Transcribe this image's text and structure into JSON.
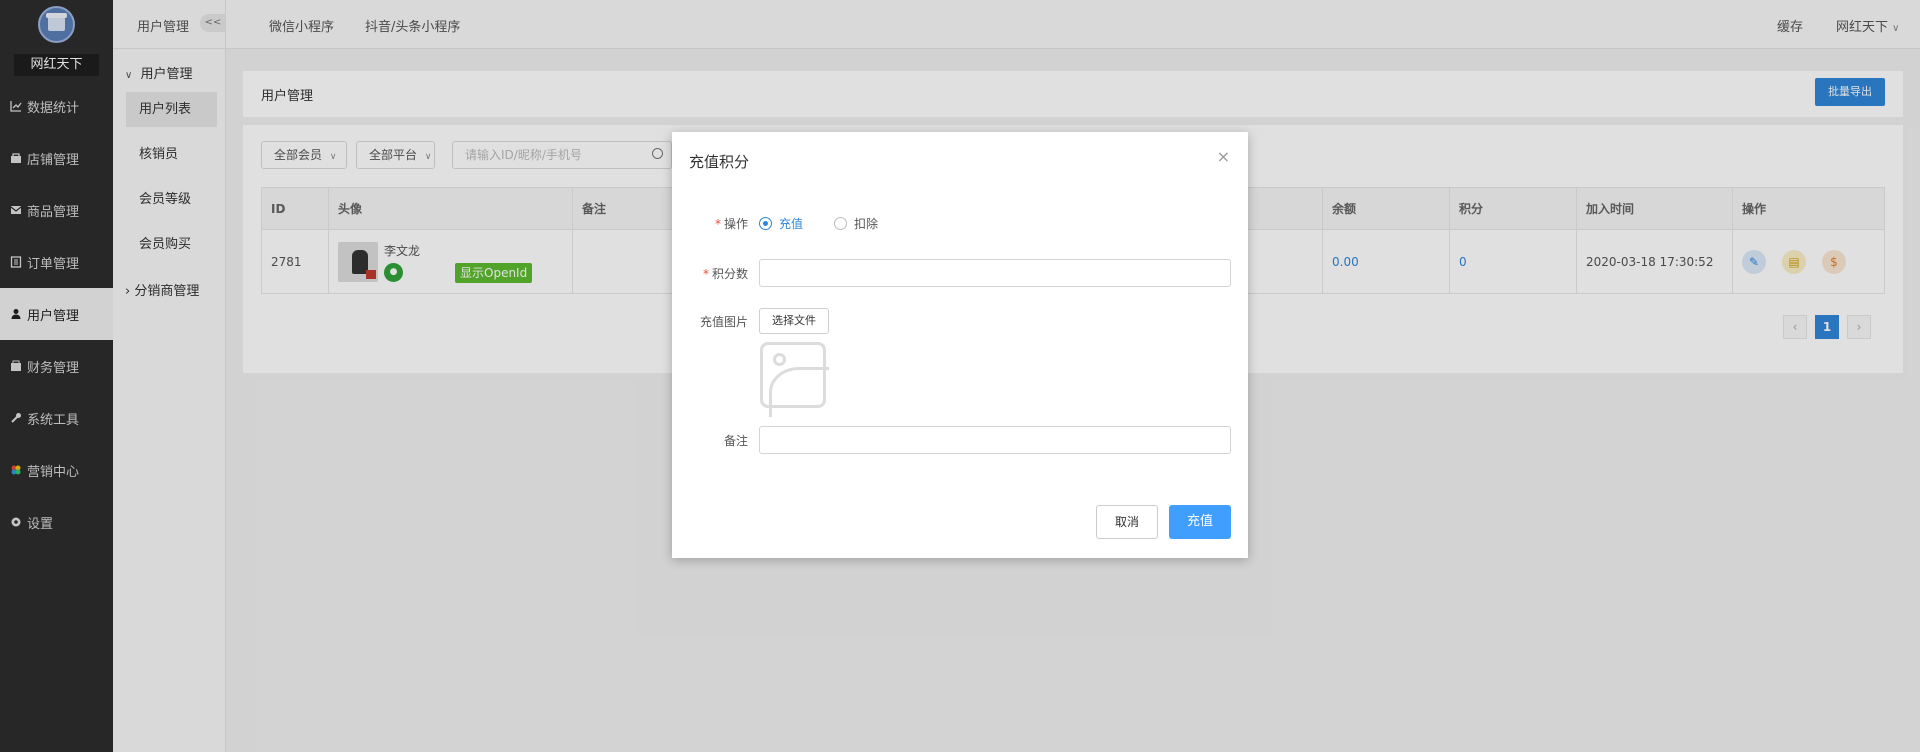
{
  "sidebar": {
    "brand": "网红天下",
    "items": [
      {
        "label": "数据统计",
        "icon": "chart-icon"
      },
      {
        "label": "店铺管理",
        "icon": "shop-icon"
      },
      {
        "label": "商品管理",
        "icon": "goods-icon"
      },
      {
        "label": "订单管理",
        "icon": "order-icon"
      },
      {
        "label": "用户管理",
        "icon": "user-icon",
        "active": true
      },
      {
        "label": "财务管理",
        "icon": "finance-icon"
      },
      {
        "label": "系统工具",
        "icon": "wrench-icon"
      },
      {
        "label": "营销中心",
        "icon": "marketing-icon"
      },
      {
        "label": "设置",
        "icon": "gear-icon"
      }
    ]
  },
  "subnav": {
    "header": "用户管理",
    "collapse": "<<",
    "group": "用户管理",
    "items": [
      "用户列表",
      "核销员",
      "会员等级",
      "会员购买"
    ],
    "group2": "分销商管理"
  },
  "topbar": {
    "tabs": [
      "微信小程序",
      "抖音/头条小程序"
    ],
    "cache": "缓存",
    "user": "网红天下"
  },
  "page": {
    "title": "用户管理",
    "export": "批量导出",
    "filters": {
      "member": "全部会员",
      "platform": "全部平台",
      "search_placeholder": "请输入ID/昵称/手机号"
    },
    "table": {
      "headers": {
        "id": "ID",
        "avatar": "头像",
        "remark": "备注",
        "balance": "余额",
        "points": "积分",
        "joined": "加入时间",
        "ops": "操作"
      },
      "row": {
        "id": "2781",
        "name": "李文龙",
        "openid_btn": "显示OpenId",
        "balance": "0.00",
        "points": "0",
        "joined": "2020-03-18 17:30:52"
      }
    },
    "pager": {
      "current": "1",
      "prev": "‹",
      "next": "›"
    }
  },
  "modal": {
    "title": "充值积分",
    "close": "×",
    "op_label": "操作",
    "op_recharge": "充值",
    "op_deduct": "扣除",
    "points_label": "积分数",
    "image_label": "充值图片",
    "file_button": "选择文件",
    "remark_label": "备注",
    "cancel": "取消",
    "confirm": "充值"
  },
  "colors": {
    "primary": "#409eff",
    "accent": "#2f86d9",
    "sidebar": "#2d2d2d",
    "green": "#5dbb2f"
  }
}
